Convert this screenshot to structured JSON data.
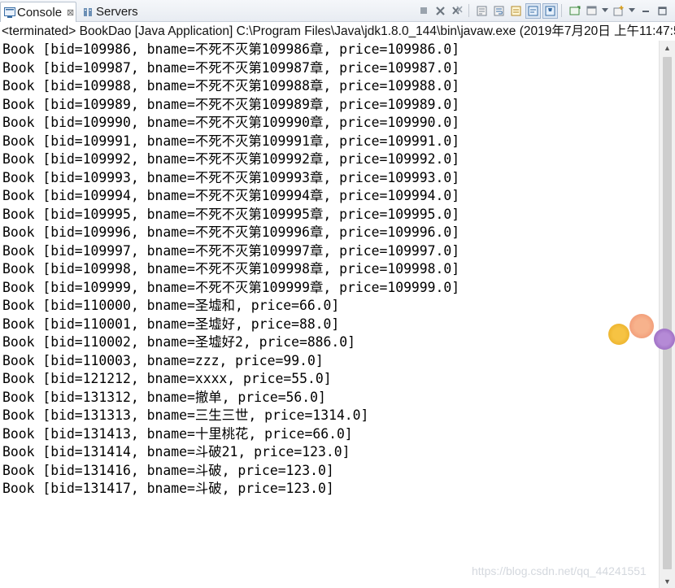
{
  "tabs": [
    {
      "label": "Console",
      "close_glyph": "⊠",
      "icon": "console-icon"
    },
    {
      "label": "Servers",
      "icon": "servers-icon"
    }
  ],
  "status_line": "<terminated> BookDao [Java Application] C:\\Program Files\\Java\\jdk1.8.0_144\\bin\\javaw.exe (2019年7月20日 上午11:47:5",
  "console_lines": [
    "Book [bid=109986, bname=不死不灭第109986章, price=109986.0]",
    "Book [bid=109987, bname=不死不灭第109987章, price=109987.0]",
    "Book [bid=109988, bname=不死不灭第109988章, price=109988.0]",
    "Book [bid=109989, bname=不死不灭第109989章, price=109989.0]",
    "Book [bid=109990, bname=不死不灭第109990章, price=109990.0]",
    "Book [bid=109991, bname=不死不灭第109991章, price=109991.0]",
    "Book [bid=109992, bname=不死不灭第109992章, price=109992.0]",
    "Book [bid=109993, bname=不死不灭第109993章, price=109993.0]",
    "Book [bid=109994, bname=不死不灭第109994章, price=109994.0]",
    "Book [bid=109995, bname=不死不灭第109995章, price=109995.0]",
    "Book [bid=109996, bname=不死不灭第109996章, price=109996.0]",
    "Book [bid=109997, bname=不死不灭第109997章, price=109997.0]",
    "Book [bid=109998, bname=不死不灭第109998章, price=109998.0]",
    "Book [bid=109999, bname=不死不灭第109999章, price=109999.0]",
    "Book [bid=110000, bname=圣墟和, price=66.0]",
    "Book [bid=110001, bname=圣墟好, price=88.0]",
    "Book [bid=110002, bname=圣墟好2, price=886.0]",
    "Book [bid=110003, bname=zzz, price=99.0]",
    "Book [bid=121212, bname=xxxx, price=55.0]",
    "Book [bid=131312, bname=撤单, price=56.0]",
    "Book [bid=131313, bname=三生三世, price=1314.0]",
    "Book [bid=131413, bname=十里桃花, price=66.0]",
    "Book [bid=131414, bname=斗破21, price=123.0]",
    "Book [bid=131416, bname=斗破, price=123.0]",
    "Book [bid=131417, bname=斗破, price=123.0]"
  ],
  "toolbar_icons": [
    "terminate-icon",
    "remove-launch-icon",
    "remove-all-terminated-icon",
    "scroll-lock-icon",
    "word-wrap-icon",
    "show-on-output-icon",
    "show-on-error-icon",
    "pin-console-icon",
    "display-selected-console-icon",
    "open-console-icon",
    "minimize-icon",
    "maximize-icon"
  ],
  "watermark": "https://blog.csdn.net/qq_44241551",
  "colors": {
    "tab_active_bg": "#ffffff",
    "tabbar_bg": "#e8ecf2",
    "thumb": "#cdcdcd"
  }
}
